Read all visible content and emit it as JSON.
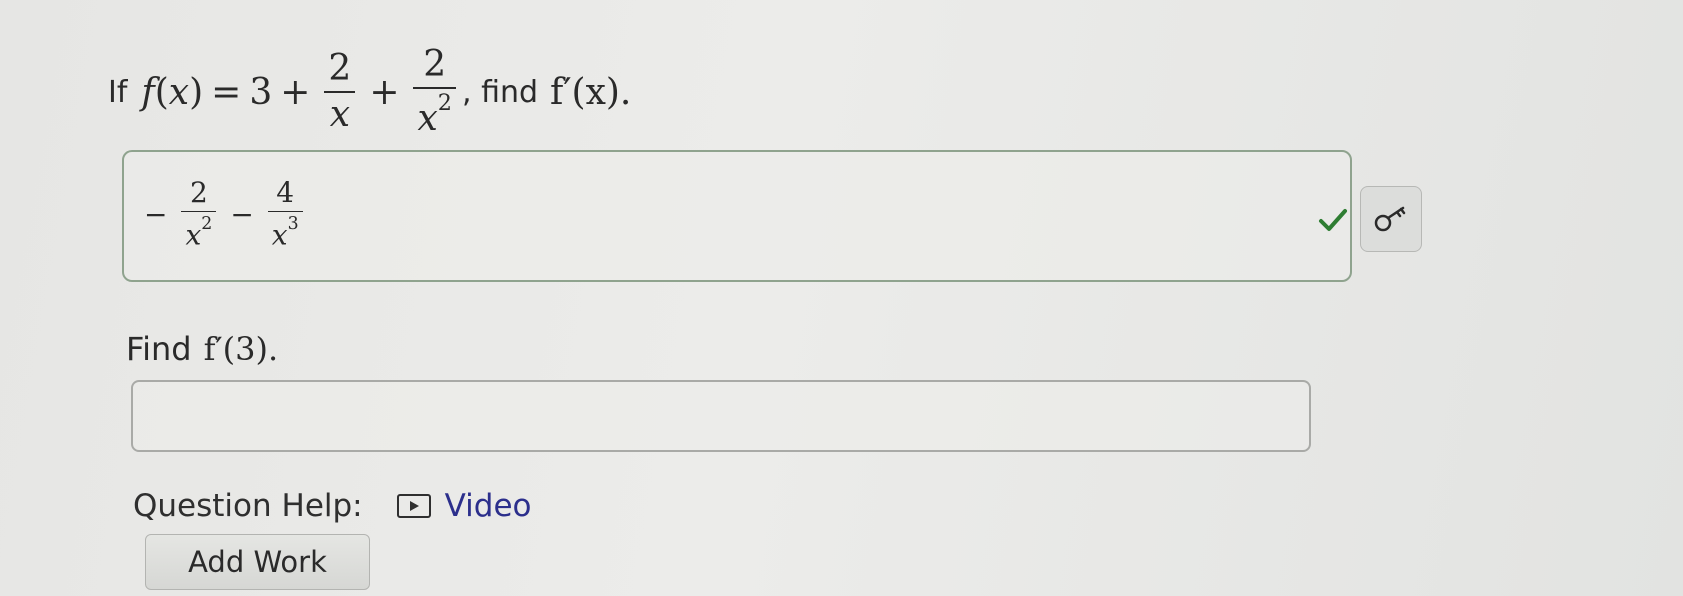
{
  "question": {
    "prefix": "If",
    "func": "f",
    "var": "x",
    "constant": "3",
    "term1_num": "2",
    "term1_den": "x",
    "term2_num": "2",
    "term2_den": "x",
    "term2_den_exp": "2",
    "find_text": ", find",
    "target": "f′(x)."
  },
  "answer1": {
    "term1_num": "2",
    "term1_den": "x",
    "term1_exp": "2",
    "term2_num": "4",
    "term2_den": "x",
    "term2_exp": "3",
    "status": "correct",
    "status_icon": "check-icon",
    "key_icon": "key-icon",
    "status_color": "#2e7d32"
  },
  "part2": {
    "prefix": "Find",
    "target": "f′(3).",
    "input_value": ""
  },
  "help": {
    "label": "Question Help:",
    "video_label": "Video",
    "video_icon": "play-icon",
    "link_color": "#2c2f8c"
  },
  "add_work_label": "Add Work"
}
